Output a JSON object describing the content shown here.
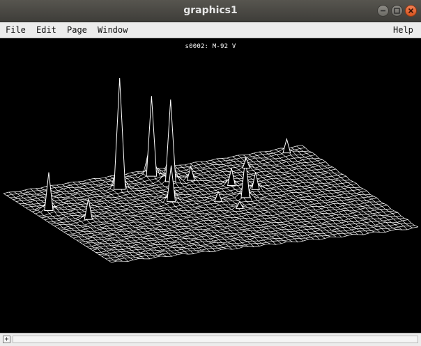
{
  "window": {
    "title": "graphics1"
  },
  "menubar": {
    "file": "File",
    "edit": "Edit",
    "page": "Page",
    "window": "Window",
    "help": "Help"
  },
  "plot": {
    "label": "s0002: M-92 V",
    "foreground": "#ffffff",
    "background": "#000000"
  },
  "statusbar": {
    "scroll_symbol": "+"
  },
  "icons": {
    "minimize": "minimize-icon",
    "maximize": "maximize-icon",
    "close": "close-icon"
  }
}
